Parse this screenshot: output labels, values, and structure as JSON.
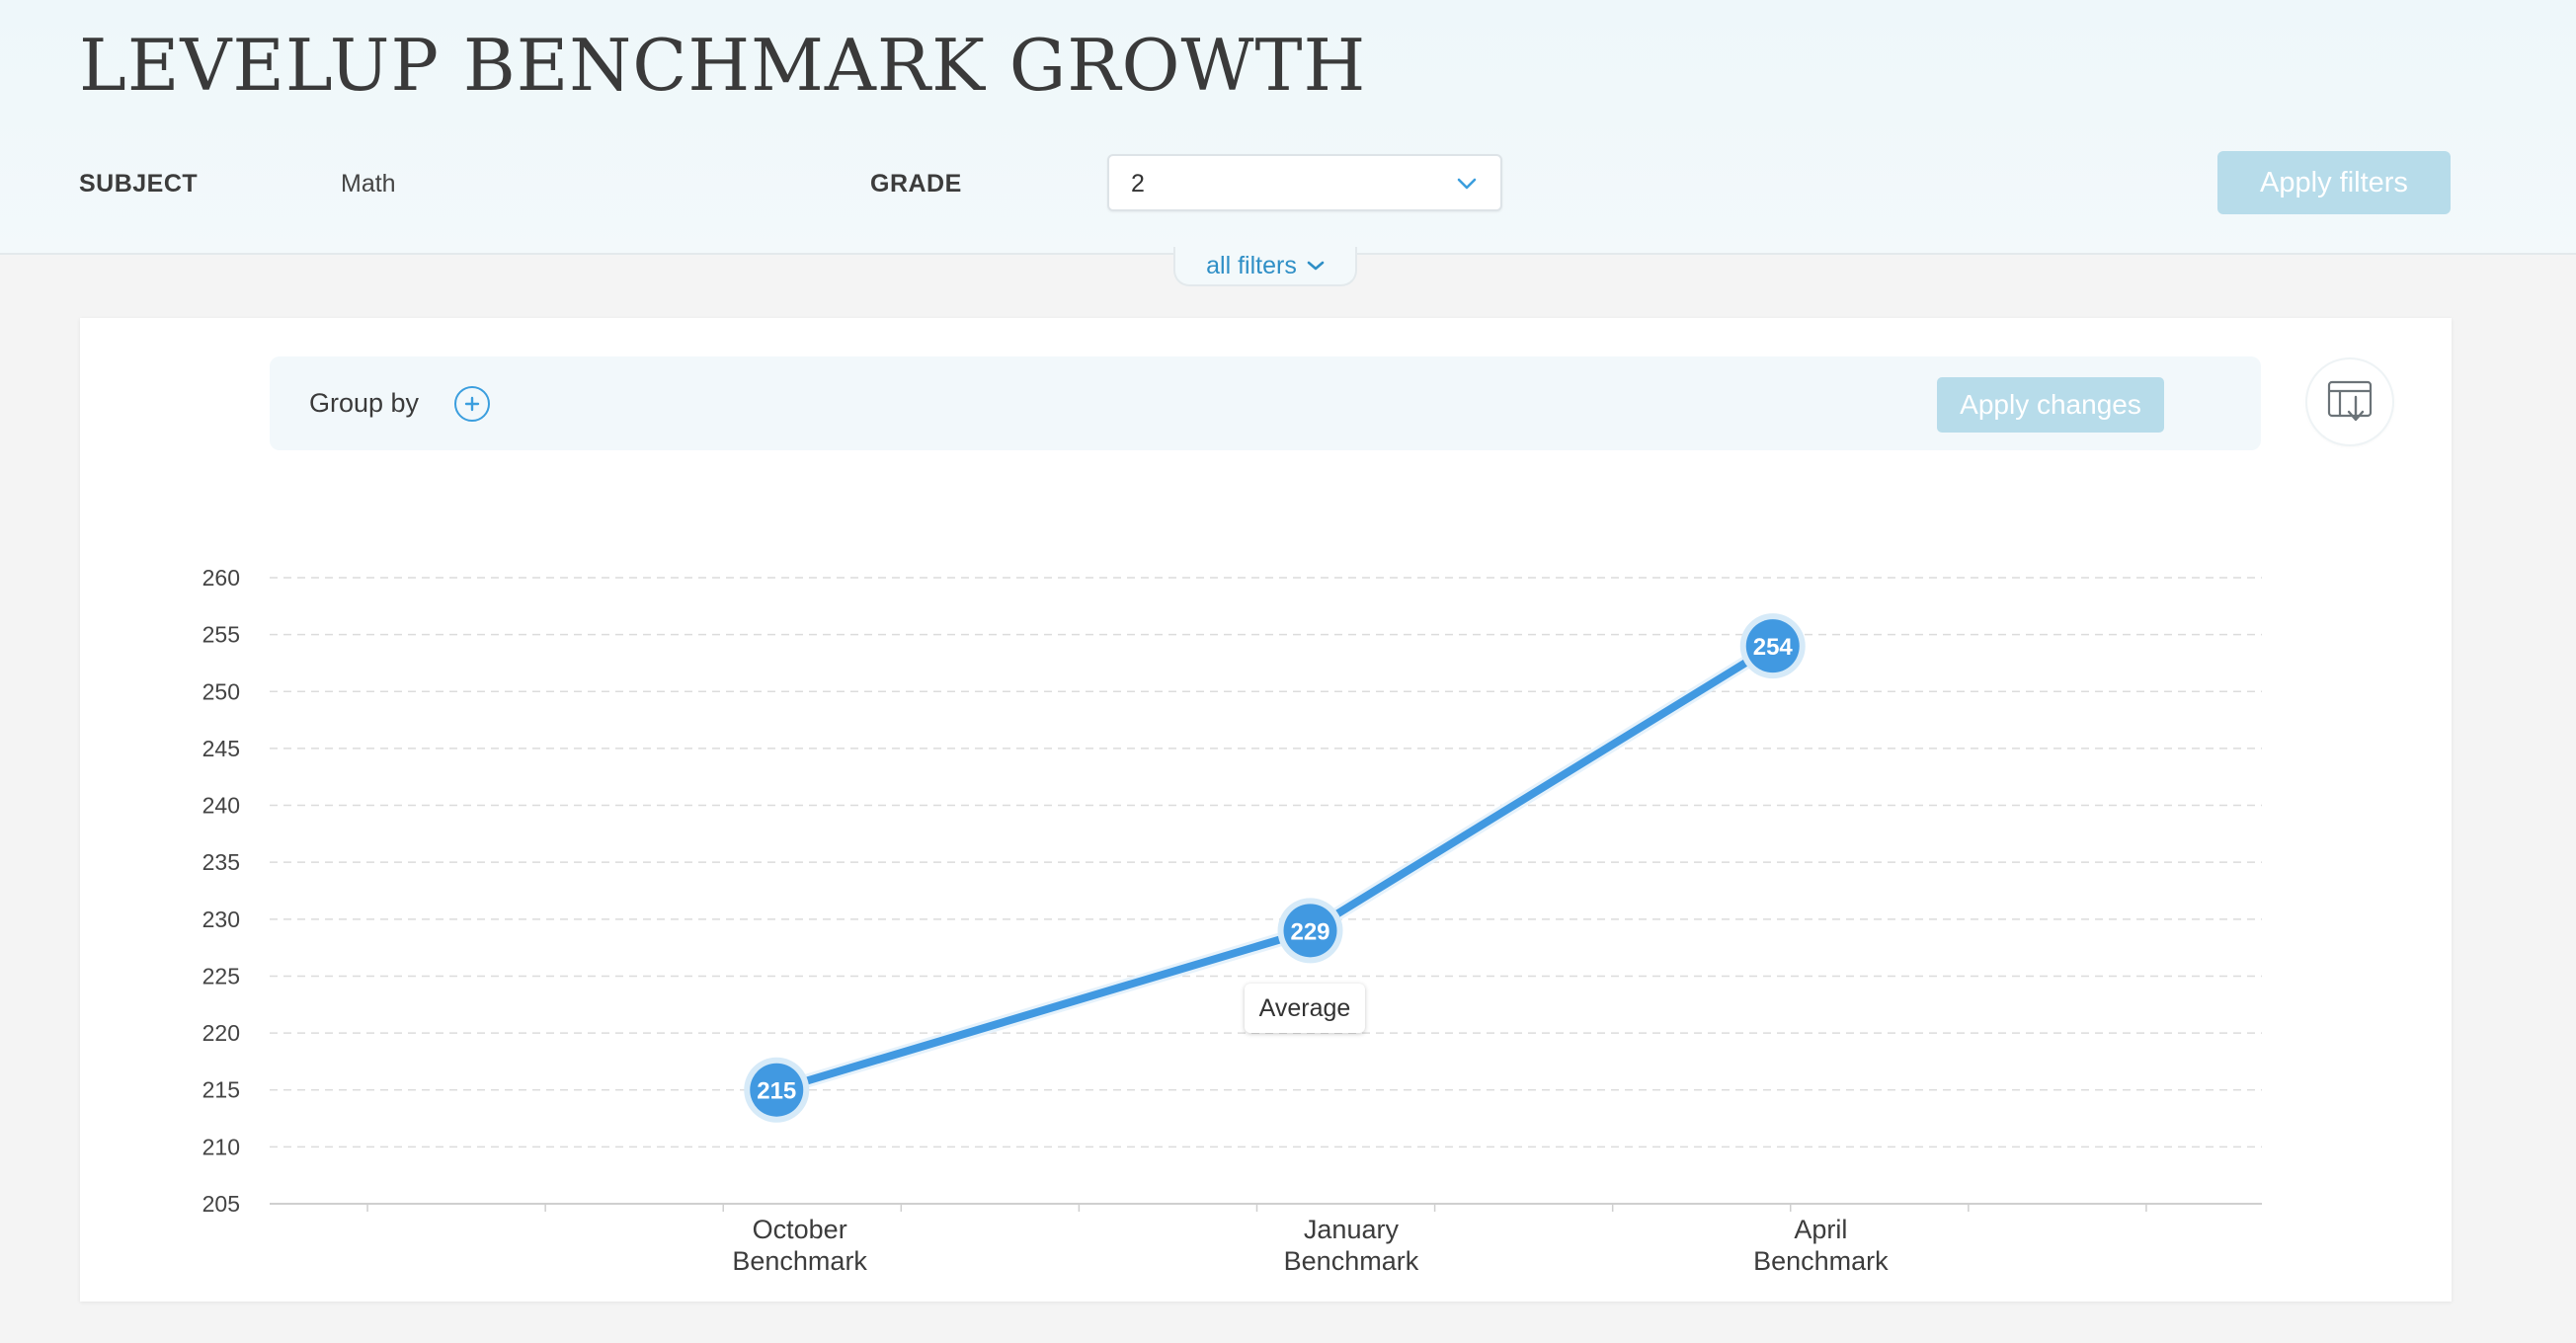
{
  "header": {
    "title": "LEVELUP BENCHMARK GROWTH",
    "subject_label": "SUBJECT",
    "subject_value": "Math",
    "grade_label": "GRADE",
    "grade_value": "2",
    "apply_filters_label": "Apply filters",
    "all_filters_label": "all filters"
  },
  "toolbar": {
    "group_by_label": "Group by",
    "apply_changes_label": "Apply changes"
  },
  "colors": {
    "accent": "#3b9ede",
    "line": "#4199e1",
    "disabled_button": "#b7dcea"
  },
  "chart_data": {
    "type": "line",
    "categories": [
      "October\nBenchmark",
      "January\nBenchmark",
      "April\nBenchmark"
    ],
    "x": [
      2.85,
      5.85,
      8.45
    ],
    "series": [
      {
        "values": [
          215,
          229,
          254
        ]
      }
    ],
    "ylim": [
      205,
      260
    ],
    "yticks": [
      205,
      210,
      215,
      220,
      225,
      230,
      235,
      240,
      245,
      250,
      255,
      260
    ],
    "xlim": [
      0,
      11.2
    ],
    "grid": true,
    "tooltip": {
      "label": "Average"
    }
  }
}
